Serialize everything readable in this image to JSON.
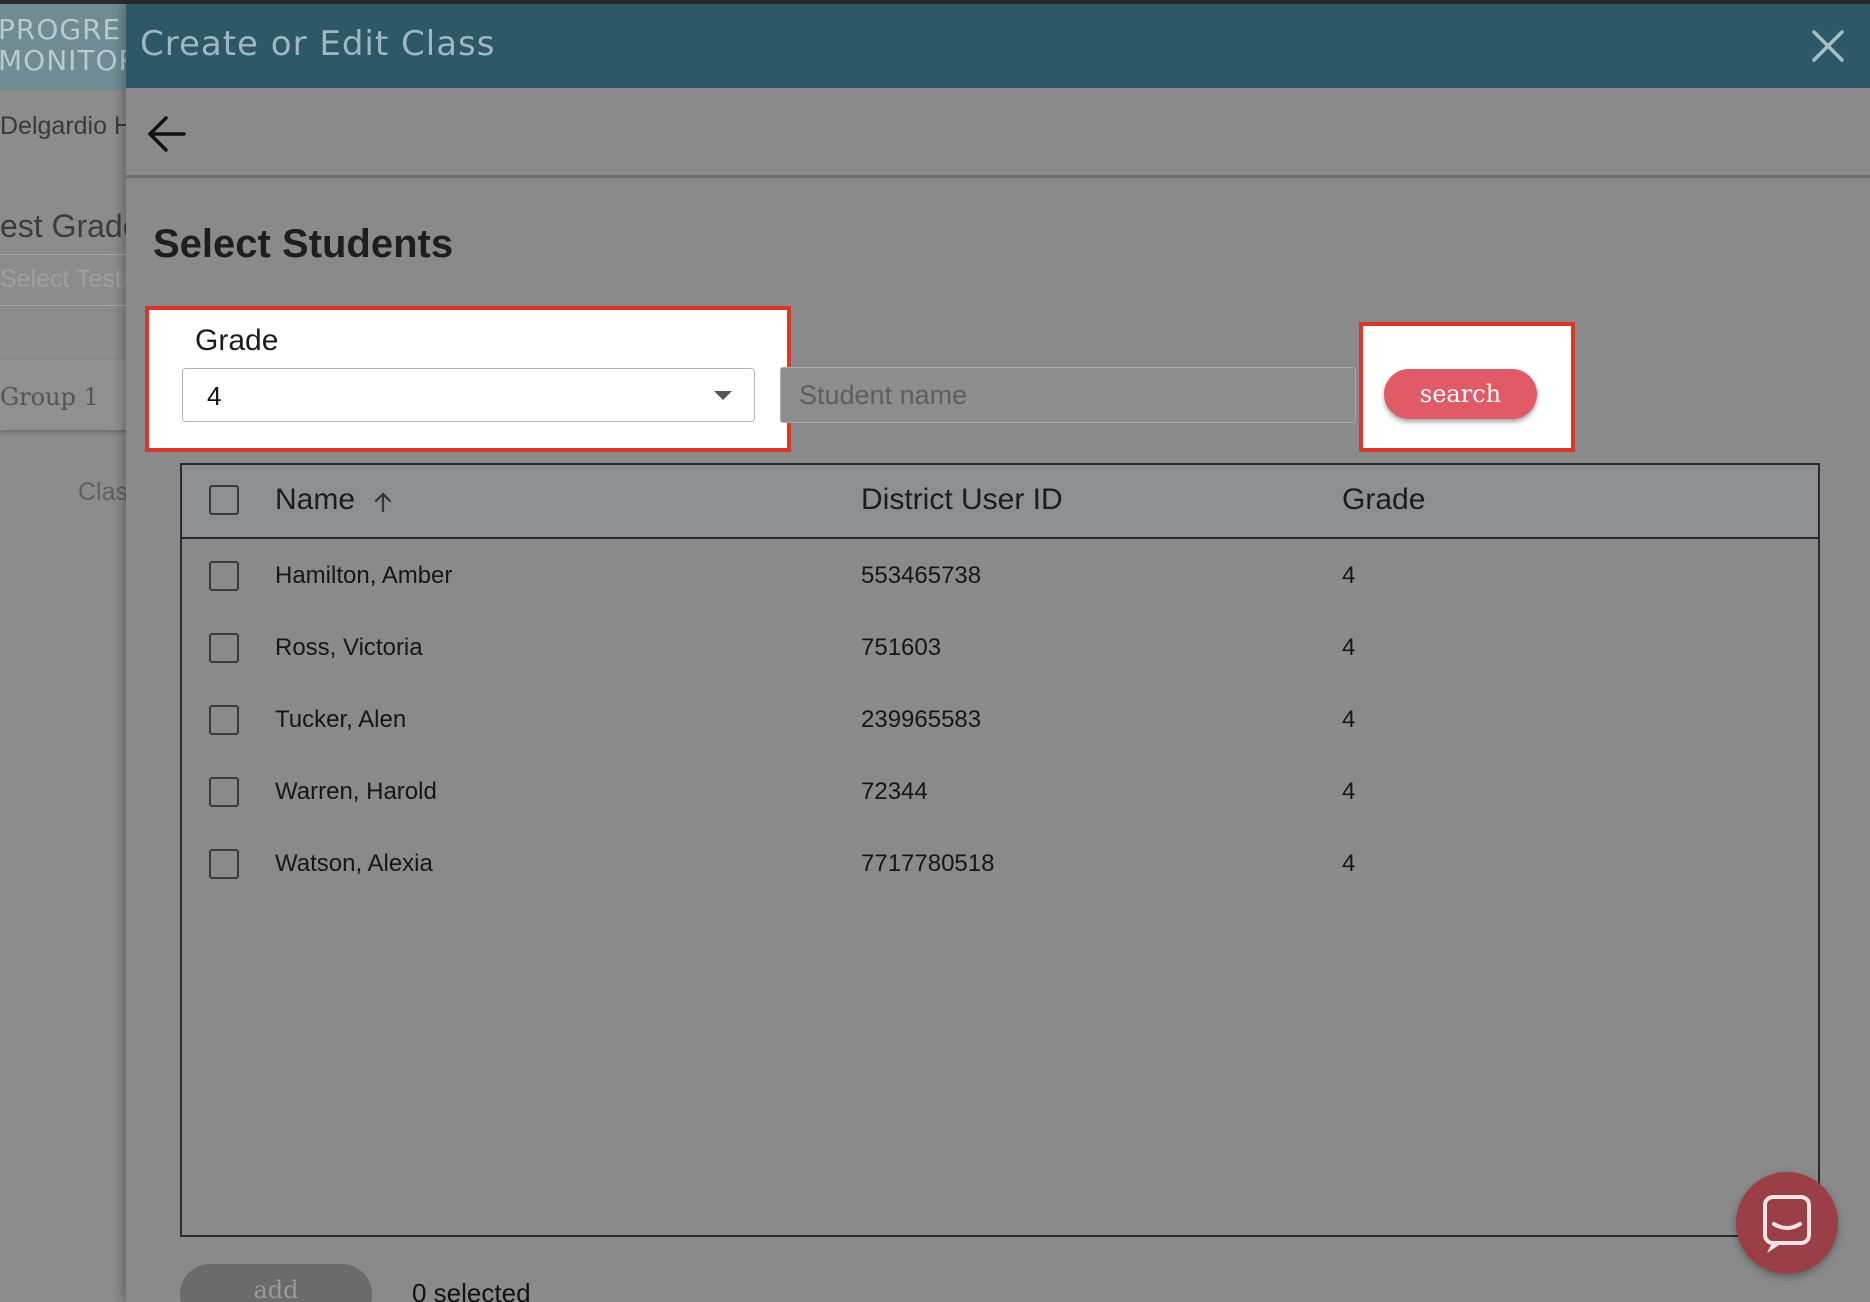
{
  "background": {
    "logo_line1": "PROGRE",
    "logo_line2": "MONITOR",
    "school_name": "Delgardio H",
    "test_grade_label": "est Grade",
    "select_test_placeholder": "Select Test",
    "group_name": "Group 1",
    "class_label": "Clas"
  },
  "modal": {
    "title": "Create or Edit Class",
    "close_icon": "close-icon",
    "back_icon": "arrow-left-icon",
    "section_title": "Select Students"
  },
  "filters": {
    "grade_label": "Grade",
    "grade_value": "4",
    "student_name_placeholder": "Student name",
    "student_name_value": "",
    "search_label": "search"
  },
  "table": {
    "columns": [
      "Name",
      "District User ID",
      "Grade"
    ],
    "sort_icon": "arrow-up-icon",
    "rows": [
      {
        "name": "Hamilton, Amber",
        "district_id": "553465738",
        "grade": "4"
      },
      {
        "name": "Ross, Victoria",
        "district_id": "751603",
        "grade": "4"
      },
      {
        "name": "Tucker, Alen",
        "district_id": "239965583",
        "grade": "4"
      },
      {
        "name": "Warren, Harold",
        "district_id": "72344",
        "grade": "4"
      },
      {
        "name": "Watson, Alexia",
        "district_id": "7717780518",
        "grade": "4"
      }
    ]
  },
  "footer": {
    "add_label": "add",
    "selected_text": "0 selected"
  },
  "colors": {
    "header": "#2c5868",
    "highlight_border": "#d8382b",
    "search_button": "#e05a68",
    "chat_launcher": "#9a3f45"
  }
}
